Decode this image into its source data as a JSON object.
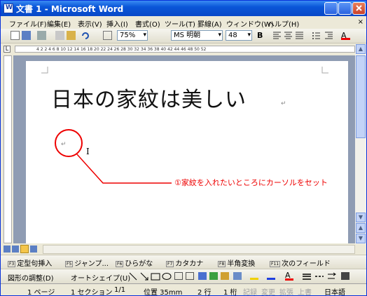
{
  "window": {
    "title": "文書 1 - Microsoft Word"
  },
  "menu": {
    "items": [
      "ファイル(F)",
      "編集(E)",
      "表示(V)",
      "挿入(I)",
      "書式(O)",
      "ツール(T)",
      "罫線(A)",
      "ウィンドウ(W)",
      "ヘルプ(H)"
    ]
  },
  "toolbar": {
    "zoom": "75%",
    "font_name": "MS 明朝",
    "font_size": "48",
    "bold": "B"
  },
  "ruler": {
    "numbers": "4  2  2  4  6  8  10  12  14  16  18  20  22  24  26  28  30  32  34  36  38  40  42  44  46  48  50  52"
  },
  "document": {
    "heading": "日本の家紋は美しい",
    "paragraph_mark": "↵",
    "annotation": "①家紋を入れたいところにカーソルをセット"
  },
  "function_keys": {
    "f3": {
      "key": "F3",
      "label": "定型句挿入"
    },
    "f5": {
      "key": "F5",
      "label": "ジャンプ..."
    },
    "f6": {
      "key": "F6",
      "label": "ひらがな"
    },
    "f7": {
      "key": "F7",
      "label": "カタカナ"
    },
    "f8": {
      "key": "F8",
      "label": "半角変換"
    },
    "f11": {
      "key": "F11",
      "label": "次のフィールド"
    }
  },
  "drawing": {
    "adjust": "図形の調整(D)",
    "autoshape": "オートシェイプ(U)"
  },
  "status": {
    "page": "1 ページ",
    "section": "1 セクション",
    "pages": "1/1",
    "position": "位置 35mm",
    "line": "2 行",
    "column": "1 桁",
    "rec": "記録",
    "trk": "変更",
    "ext": "拡張",
    "ovr": "上書",
    "language": "日本語"
  },
  "colors": {
    "annotation": "#e00000",
    "titlebar": "#0a56d8",
    "document_bg": "#8f9cb3"
  }
}
